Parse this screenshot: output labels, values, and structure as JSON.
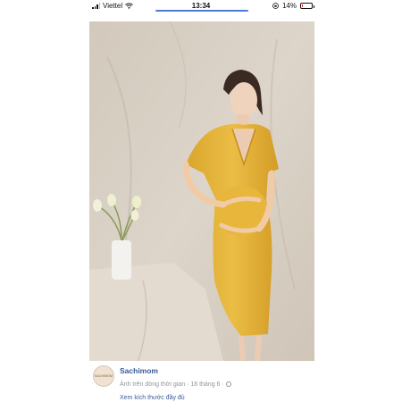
{
  "status_bar": {
    "carrier": "Viettel",
    "time": "13:34",
    "battery_percent": "14%",
    "battery_level": 0.14
  },
  "post": {
    "page_name": "Sachimom",
    "avatar_text": "SACHIMOM",
    "album": "Ảnh trên dòng thời gian",
    "separator": "·",
    "date": "18 tháng 6",
    "date_suffix": "·",
    "view_full_size": "Xem kích thước đầy đủ"
  },
  "colors": {
    "link": "#385898",
    "meta": "#90949c",
    "dress": "#e3b53a",
    "backdrop": "#d9d0c4"
  }
}
